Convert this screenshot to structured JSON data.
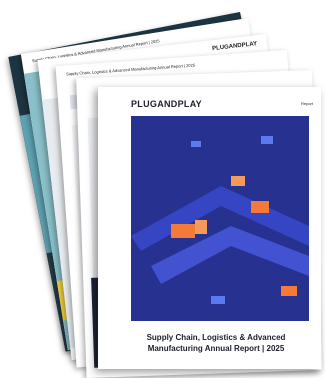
{
  "back_pages": {
    "page2_header": "Supply Chain, Logistics & Advanced Manufacturing Annual Report | 2025",
    "page3_brand": "PLUGANDPLAY",
    "page4_header": "Supply Chain, Logistics & Advanced Manufacturing Annual Report | 2025"
  },
  "cover": {
    "logo": "PLUGANDPLAY",
    "tag": "Report",
    "title_line1": "Supply Chain, Logistics & Advanced",
    "title_line2": "Manufacturing Annual Report | 2025"
  },
  "colors": {
    "art_bg": "#27318f",
    "accent_orange": "#f47a3a",
    "accent_yellow": "#f1d23a"
  }
}
